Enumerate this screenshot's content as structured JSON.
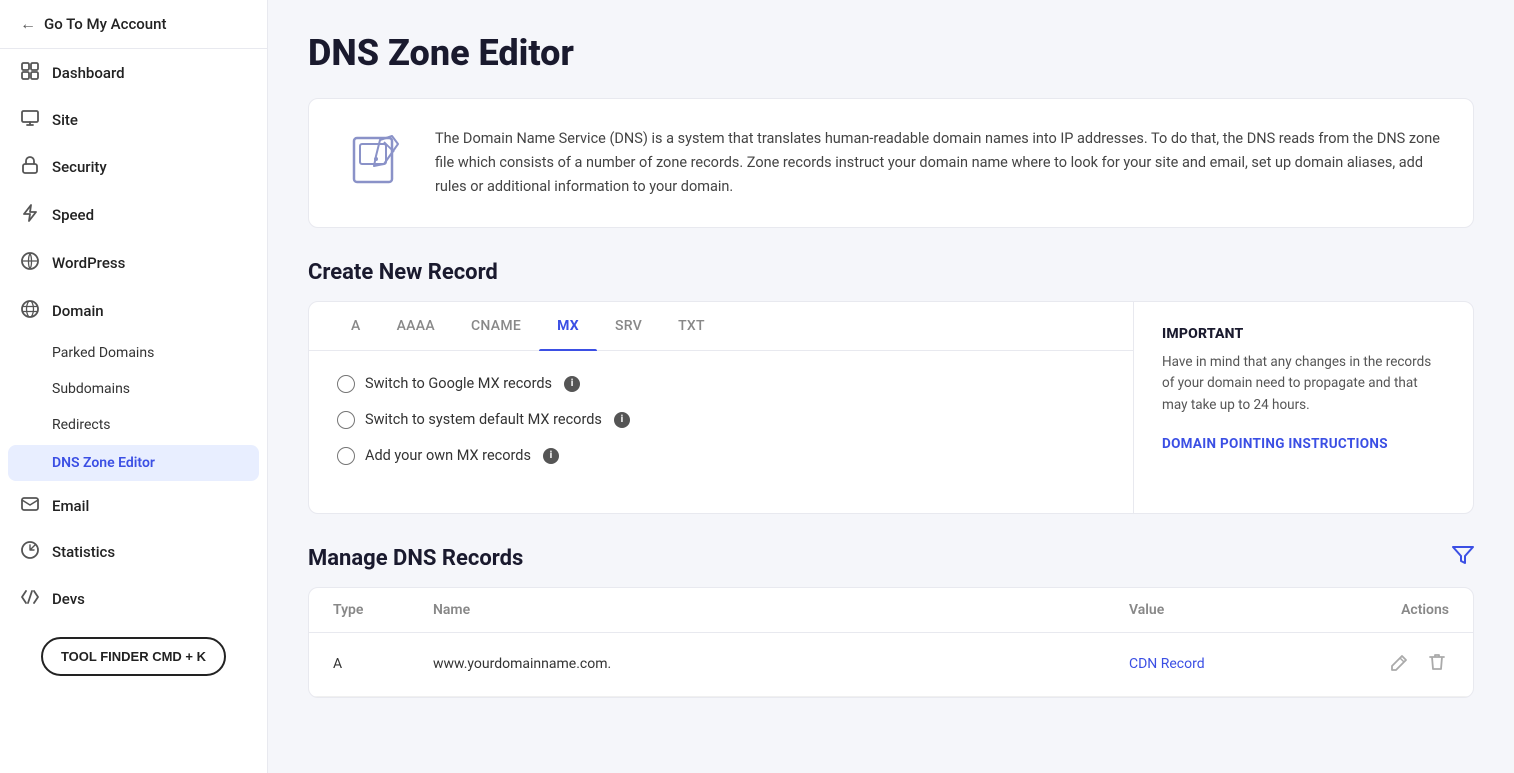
{
  "sidebar": {
    "go_to_account": "Go To My Account",
    "items": [
      {
        "label": "Dashboard",
        "icon": "grid"
      },
      {
        "label": "Site",
        "icon": "monitor"
      },
      {
        "label": "Security",
        "icon": "lock"
      },
      {
        "label": "Speed",
        "icon": "lightning"
      },
      {
        "label": "WordPress",
        "icon": "wp"
      },
      {
        "label": "Domain",
        "icon": "globe"
      }
    ],
    "sub_items": [
      {
        "label": "Parked Domains"
      },
      {
        "label": "Subdomains"
      },
      {
        "label": "Redirects"
      },
      {
        "label": "DNS Zone Editor",
        "active": true
      }
    ],
    "more_items": [
      {
        "label": "Email",
        "icon": "email"
      },
      {
        "label": "Statistics",
        "icon": "chart"
      },
      {
        "label": "Devs",
        "icon": "devs"
      }
    ],
    "tool_finder": "TOOL FINDER CMD + K"
  },
  "page": {
    "title": "DNS Zone Editor",
    "info_text": "The Domain Name Service (DNS) is a system that translates human-readable domain names into IP addresses. To do that, the DNS reads from the DNS zone file which consists of a number of zone records. Zone records instruct your domain name where to look for your site and email, set up domain aliases, add rules or additional information to your domain."
  },
  "create_record": {
    "section_title": "Create New Record",
    "tabs": [
      "A",
      "AAAA",
      "CNAME",
      "MX",
      "SRV",
      "TXT"
    ],
    "active_tab": "MX",
    "options": [
      {
        "label": "Switch to Google MX records"
      },
      {
        "label": "Switch to system default MX records"
      },
      {
        "label": "Add your own MX records"
      }
    ],
    "important_title": "IMPORTANT",
    "important_text": "Have in mind that any changes in the records of your domain need to propagate and that may take up to 24 hours.",
    "domain_pointing_link": "DOMAIN POINTING INSTRUCTIONS"
  },
  "manage_dns": {
    "section_title": "Manage DNS Records",
    "columns": [
      "Type",
      "Name",
      "Value",
      "Actions"
    ],
    "rows": [
      {
        "type": "A",
        "name": "www.yourdomainname.com.",
        "value": "CDN Record",
        "value_is_link": true
      }
    ]
  }
}
